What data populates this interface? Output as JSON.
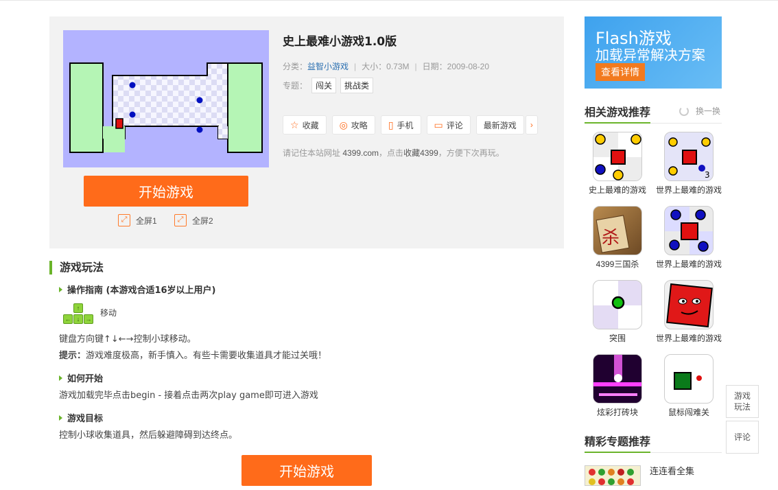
{
  "game": {
    "title": "史上最难小游戏1.0版",
    "category_label": "分类：",
    "category": "益智小游戏",
    "size": "大小：0.73M",
    "date": "日期：2009-08-20",
    "topics_label": "专题：",
    "topics": [
      "闯关",
      "挑战类"
    ]
  },
  "start_button": "开始游戏",
  "fullscreen": [
    "全屏1",
    "全屏2"
  ],
  "actions": [
    {
      "icon": "star-icon",
      "glyph": "☆",
      "label": "收藏"
    },
    {
      "icon": "guide-icon",
      "glyph": "◎",
      "label": "攻略"
    },
    {
      "icon": "phone-icon",
      "glyph": "▯",
      "label": "手机"
    },
    {
      "icon": "comment-icon",
      "glyph": "▭",
      "label": "评论"
    },
    {
      "icon": "",
      "glyph": "",
      "label": "最新游戏"
    }
  ],
  "actions_more": "›",
  "remember": {
    "pre": "请记住本站网址 ",
    "site": "4399.com",
    "mid": "，点击",
    "fav": "收藏4399",
    "post": "，方便下次再玩。"
  },
  "howto": {
    "title": "游戏玩法",
    "guide_title": "操作指南 (本游戏合适16岁以上用户)",
    "move_label": "移动",
    "controls_text": "键盘方向键↑↓←→控制小球移动。",
    "tip_label": "提示：",
    "tip_text": "游戏难度极高，新手慎入。有些卡需要收集道具才能过关哦！",
    "start_title": "如何开始",
    "start_text": "游戏加载完毕点击begin - 接着点击两次play game即可进入游戏",
    "goal_title": "游戏目标",
    "goal_text": "控制小球收集道具，然后躲避障碍到达终点。"
  },
  "ad": {
    "line1": "Flash游戏",
    "line2": "加载异常解决方案",
    "button": "查看详情",
    "color": "#4aa8f0"
  },
  "related": {
    "title": "相关游戏推荐",
    "refresh": "换一换",
    "games": [
      {
        "name": "史上最难的游戏",
        "icon": "dots-grid"
      },
      {
        "name": "世界上最难的游戏",
        "icon": "red-square-3"
      },
      {
        "name": "4399三国杀",
        "icon": "sanguosha"
      },
      {
        "name": "世界上最难的游戏",
        "icon": "red-square-blue-dots"
      },
      {
        "name": "突围",
        "icon": "green-dot"
      },
      {
        "name": "世界上最难的游戏",
        "icon": "red-face"
      },
      {
        "name": "炫彩打砖块",
        "icon": "breakout"
      },
      {
        "name": "鼠标闯难关",
        "icon": "green-square"
      }
    ]
  },
  "topics_section": {
    "title": "精彩专题推荐",
    "item": "连连看全集"
  },
  "float": {
    "howto": "游戏玩法",
    "comment": "评论"
  },
  "colors": {
    "accent": "#ff6b1a",
    "green": "#6ab42a",
    "link": "#2a6fb0"
  }
}
